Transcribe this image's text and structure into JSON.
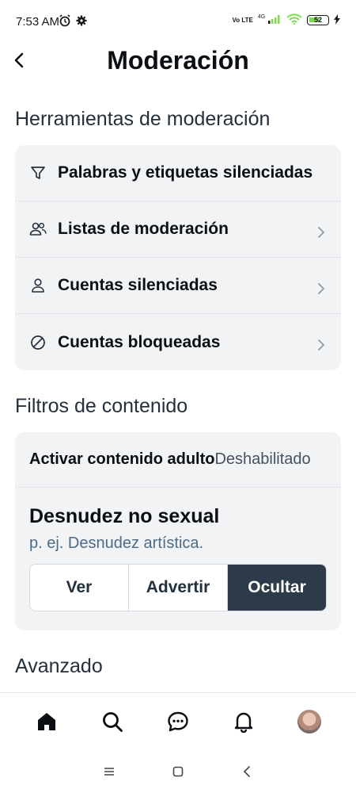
{
  "status_bar": {
    "time": "7:53 AM",
    "network_label": "Vo LTE",
    "network_type": "4G",
    "battery": "52"
  },
  "header": {
    "title": "Moderación"
  },
  "sections": {
    "tools_title": "Herramientas de moderación",
    "filters_title": "Filtros de contenido",
    "advanced_title": "Avanzado"
  },
  "tools": [
    {
      "icon": "filter-icon",
      "label": "Palabras y etiquetas silenciadas"
    },
    {
      "icon": "users-icon",
      "label": "Listas de moderación"
    },
    {
      "icon": "user-icon",
      "label": "Cuentas silenciadas"
    },
    {
      "icon": "block-icon",
      "label": "Cuentas bloqueadas"
    }
  ],
  "filters": {
    "adult_label": "Activar contenido adulto",
    "adult_value": "Deshabilitado",
    "nudity_title": "Desnudez no sexual",
    "nudity_desc": "p. ej. Desnudez artística.",
    "options": [
      "Ver",
      "Advertir",
      "Ocultar"
    ],
    "selected": "Ocultar"
  },
  "bottom_nav": [
    "home-icon",
    "search-icon",
    "chat-icon",
    "bell-icon",
    "avatar"
  ],
  "colors": {
    "card_bg": "#f1f3f5",
    "active_segment": "#2c3a4a",
    "subtle_text": "#4d6a86"
  }
}
